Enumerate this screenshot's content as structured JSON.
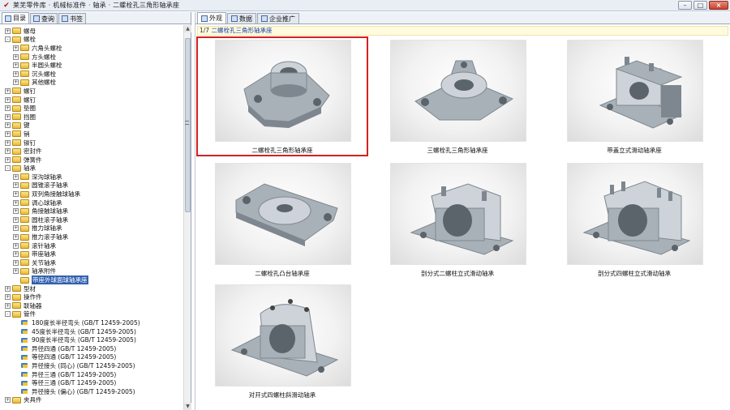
{
  "window": {
    "title": "莱芜零件库 · 机械标准件 · 轴承 · 二螺栓孔三角形轴承座",
    "controls": [
      "–",
      "□",
      "×"
    ]
  },
  "left_tabs": [
    {
      "label": "目录",
      "icon": "tree-icon"
    },
    {
      "label": "查询",
      "icon": "search-icon"
    },
    {
      "label": "书签",
      "icon": "bookmark-icon"
    }
  ],
  "tree": [
    {
      "level": 0,
      "exp": "+",
      "label": "螺母"
    },
    {
      "level": 0,
      "exp": "-",
      "label": "螺栓"
    },
    {
      "level": 1,
      "exp": "+",
      "label": "六角头螺栓"
    },
    {
      "level": 1,
      "exp": "+",
      "label": "方头螺栓"
    },
    {
      "level": 1,
      "exp": "+",
      "label": "半圆头螺栓"
    },
    {
      "level": 1,
      "exp": "+",
      "label": "沉头螺栓"
    },
    {
      "level": 1,
      "exp": "+",
      "label": "其他螺栓"
    },
    {
      "level": 0,
      "exp": "+",
      "label": "螺钉"
    },
    {
      "level": 0,
      "exp": "+",
      "label": "螺钉"
    },
    {
      "level": 0,
      "exp": "+",
      "label": "垫圈"
    },
    {
      "level": 0,
      "exp": "+",
      "label": "挡圈"
    },
    {
      "level": 0,
      "exp": "+",
      "label": "键"
    },
    {
      "level": 0,
      "exp": "+",
      "label": "销"
    },
    {
      "level": 0,
      "exp": "+",
      "label": "铆钉"
    },
    {
      "level": 0,
      "exp": "+",
      "label": "密封件"
    },
    {
      "level": 0,
      "exp": "+",
      "label": "弹簧件"
    },
    {
      "level": 0,
      "exp": "-",
      "label": "轴承"
    },
    {
      "level": 1,
      "exp": "+",
      "label": "深沟球轴承"
    },
    {
      "level": 1,
      "exp": "+",
      "label": "圆锥滚子轴承"
    },
    {
      "level": 1,
      "exp": "+",
      "label": "双列角接触球轴承"
    },
    {
      "level": 1,
      "exp": "+",
      "label": "调心球轴承"
    },
    {
      "level": 1,
      "exp": "+",
      "label": "角接触球轴承"
    },
    {
      "level": 1,
      "exp": "+",
      "label": "圆柱滚子轴承"
    },
    {
      "level": 1,
      "exp": "+",
      "label": "推力球轴承"
    },
    {
      "level": 1,
      "exp": "+",
      "label": "推力滚子轴承"
    },
    {
      "level": 1,
      "exp": "+",
      "label": "滚针轴承"
    },
    {
      "level": 1,
      "exp": "+",
      "label": "带座轴承"
    },
    {
      "level": 1,
      "exp": "+",
      "label": "关节轴承"
    },
    {
      "level": 1,
      "exp": "+",
      "label": "轴承附件"
    },
    {
      "level": 1,
      "exp": " ",
      "label": "带座外球面球轴承座",
      "selected": true
    },
    {
      "level": 0,
      "exp": "+",
      "label": "型材"
    },
    {
      "level": 0,
      "exp": "+",
      "label": "操作件"
    },
    {
      "level": 0,
      "exp": "+",
      "label": "联轴器"
    },
    {
      "level": 0,
      "exp": "-",
      "label": "管件"
    },
    {
      "level": 1,
      "exp": " ",
      "label": "180度长半径弯头 (GB/T 12459-2005)",
      "leaf": true
    },
    {
      "level": 1,
      "exp": " ",
      "label": "45度长半径弯头 (GB/T 12459-2005)",
      "leaf": true
    },
    {
      "level": 1,
      "exp": " ",
      "label": "90度长半径弯头 (GB/T 12459-2005)",
      "leaf": true
    },
    {
      "level": 1,
      "exp": " ",
      "label": "异径四通 (GB/T 12459-2005)",
      "leaf": true
    },
    {
      "level": 1,
      "exp": " ",
      "label": "等径四通 (GB/T 12459-2005)",
      "leaf": true
    },
    {
      "level": 1,
      "exp": " ",
      "label": "异径接头 (同心) (GB/T 12459-2005)",
      "leaf": true
    },
    {
      "level": 1,
      "exp": " ",
      "label": "异径三通 (GB/T 12459-2005)",
      "leaf": true
    },
    {
      "level": 1,
      "exp": " ",
      "label": "等径三通 (GB/T 12459-2005)",
      "leaf": true
    },
    {
      "level": 1,
      "exp": " ",
      "label": "异径接头 (偏心) (GB/T 12459-2005)",
      "leaf": true
    },
    {
      "level": 0,
      "exp": "+",
      "label": "夹具件"
    }
  ],
  "right_tabs": [
    {
      "label": "外观",
      "icon": "image-icon"
    },
    {
      "label": "数据",
      "icon": "table-icon"
    },
    {
      "label": "企业推广",
      "icon": "globe-icon"
    }
  ],
  "breadcrumb": {
    "count": "1/7",
    "text": "二螺栓孔三角形轴承座"
  },
  "tiles": [
    {
      "caption": "二螺栓孔三角形轴承座",
      "selected": true,
      "shape": "tri"
    },
    {
      "caption": "三螺栓孔三角形轴承座",
      "shape": "three"
    },
    {
      "caption": "带盖立式滑动轴承座",
      "shape": "pillow"
    },
    {
      "caption": "二螺栓孔凸台轴承座",
      "shape": "flange"
    },
    {
      "caption": "剖分式二螺柱立式滑动轴承",
      "shape": "plummer"
    },
    {
      "caption": "剖分式四螺柱立式滑动轴承",
      "shape": "plummer4"
    },
    {
      "caption": "对开式四螺柱斜滑动轴承",
      "shape": "diag"
    }
  ]
}
